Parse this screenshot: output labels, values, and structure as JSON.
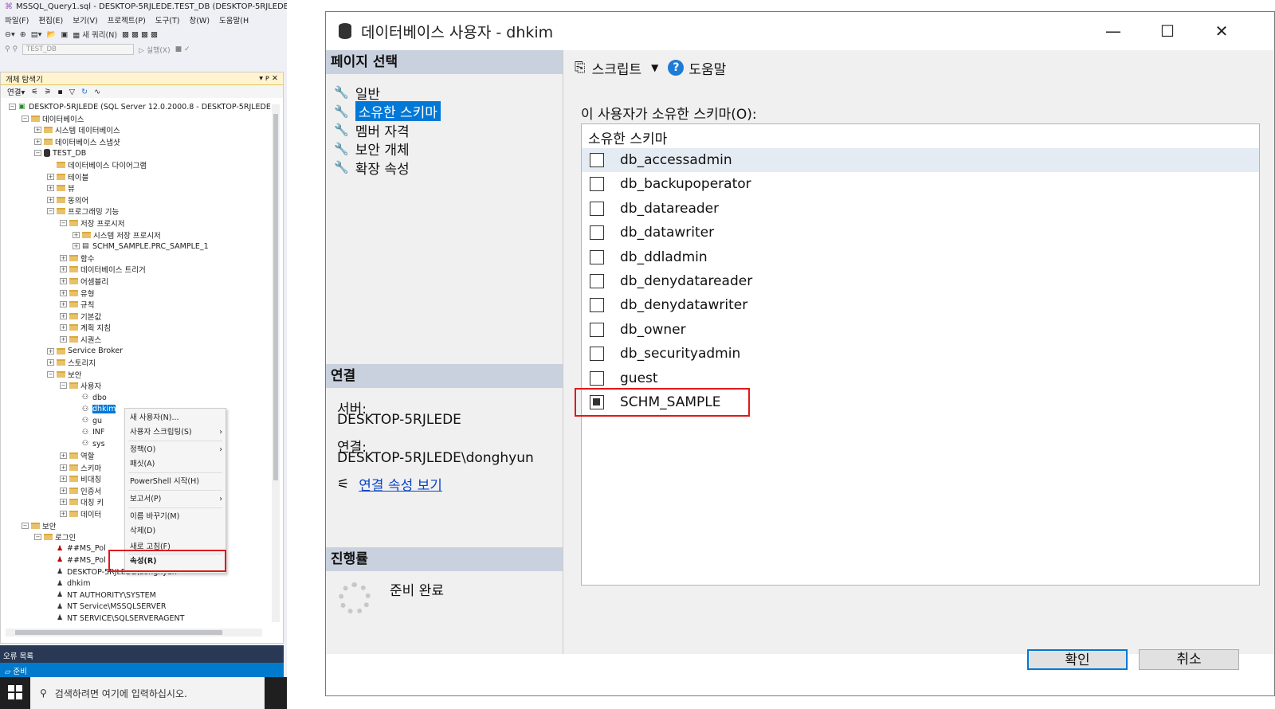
{
  "ssms": {
    "window_title": "MSSQL_Query1.sql - DESKTOP-5RJLEDE.TEST_DB (DESKTOP-5RJLEDE",
    "menu": [
      "파일(F)",
      "편집(E)",
      "보기(V)",
      "프로젝트(P)",
      "도구(T)",
      "창(W)",
      "도움말(H"
    ],
    "toolbar_new_query": "새 쿼리(N)",
    "db_select": "TEST_DB",
    "execute_label": "실행(X)",
    "object_explorer_title": "개체 탐색기",
    "object_explorer_pin": "▾ ᴘ ✕",
    "connect_label": "연결",
    "tree": [
      {
        "level": 0,
        "exp": "⊟",
        "icon": "server",
        "text": "DESKTOP-5RJLEDE (SQL Server 12.0.2000.8 - DESKTOP-5RJLEDE"
      },
      {
        "level": 1,
        "exp": "⊟",
        "icon": "folder",
        "text": "데이터베이스"
      },
      {
        "level": 2,
        "exp": "⊞",
        "icon": "folder",
        "text": "시스템 데이터베이스"
      },
      {
        "level": 2,
        "exp": "⊞",
        "icon": "folder",
        "text": "데이터베이스 스냅샷"
      },
      {
        "level": 2,
        "exp": "⊟",
        "icon": "db",
        "text": "TEST_DB"
      },
      {
        "level": 3,
        "exp": "",
        "icon": "folder",
        "text": "데이터베이스 다이어그램"
      },
      {
        "level": 3,
        "exp": "⊞",
        "icon": "folder",
        "text": "테이블"
      },
      {
        "level": 3,
        "exp": "⊞",
        "icon": "folder",
        "text": "뷰"
      },
      {
        "level": 3,
        "exp": "⊞",
        "icon": "folder",
        "text": "동의어"
      },
      {
        "level": 3,
        "exp": "⊟",
        "icon": "folder",
        "text": "프로그래밍 기능"
      },
      {
        "level": 4,
        "exp": "⊟",
        "icon": "folder",
        "text": "저장 프로시저"
      },
      {
        "level": 5,
        "exp": "⊞",
        "icon": "folder",
        "text": "시스템 저장 프로시저"
      },
      {
        "level": 5,
        "exp": "⊞",
        "icon": "proc",
        "text": "SCHM_SAMPLE.PRC_SAMPLE_1"
      },
      {
        "level": 4,
        "exp": "⊞",
        "icon": "folder",
        "text": "함수"
      },
      {
        "level": 4,
        "exp": "⊞",
        "icon": "folder",
        "text": "데이터베이스 트리거"
      },
      {
        "level": 4,
        "exp": "⊞",
        "icon": "folder",
        "text": "어셈블리"
      },
      {
        "level": 4,
        "exp": "⊞",
        "icon": "folder",
        "text": "유형"
      },
      {
        "level": 4,
        "exp": "⊞",
        "icon": "folder",
        "text": "규칙"
      },
      {
        "level": 4,
        "exp": "⊞",
        "icon": "folder",
        "text": "기본값"
      },
      {
        "level": 4,
        "exp": "⊞",
        "icon": "folder",
        "text": "계획 지침"
      },
      {
        "level": 4,
        "exp": "⊞",
        "icon": "folder",
        "text": "시퀀스"
      },
      {
        "level": 3,
        "exp": "⊞",
        "icon": "folder",
        "text": "Service Broker"
      },
      {
        "level": 3,
        "exp": "⊞",
        "icon": "folder",
        "text": "스토리지"
      },
      {
        "level": 3,
        "exp": "⊟",
        "icon": "folder",
        "text": "보안"
      },
      {
        "level": 4,
        "exp": "⊟",
        "icon": "folder",
        "text": "사용자"
      },
      {
        "level": 5,
        "exp": "",
        "icon": "user",
        "text": "dbo"
      },
      {
        "level": 5,
        "exp": "",
        "icon": "user",
        "text": "dhkim"
      },
      {
        "level": 5,
        "exp": "",
        "icon": "user",
        "text": "gu"
      },
      {
        "level": 5,
        "exp": "",
        "icon": "user",
        "text": "INF"
      },
      {
        "level": 5,
        "exp": "",
        "icon": "user",
        "text": "sys"
      },
      {
        "level": 4,
        "exp": "⊞",
        "icon": "folder",
        "text": "역할"
      },
      {
        "level": 4,
        "exp": "⊞",
        "icon": "folder",
        "text": "스키마"
      },
      {
        "level": 4,
        "exp": "⊞",
        "icon": "folder",
        "text": "비대칭"
      },
      {
        "level": 4,
        "exp": "⊞",
        "icon": "folder",
        "text": "인증서"
      },
      {
        "level": 4,
        "exp": "⊞",
        "icon": "folder",
        "text": "대칭 키"
      },
      {
        "level": 4,
        "exp": "⊞",
        "icon": "folder",
        "text": "데이터"
      },
      {
        "level": 1,
        "exp": "⊟",
        "icon": "folder",
        "text": "보안"
      },
      {
        "level": 2,
        "exp": "⊟",
        "icon": "folder",
        "text": "로그인"
      },
      {
        "level": 3,
        "exp": "",
        "icon": "login-x",
        "text": "##MS_Pol"
      },
      {
        "level": 3,
        "exp": "",
        "icon": "login-x",
        "text": "##MS_Pol"
      },
      {
        "level": 3,
        "exp": "",
        "icon": "login",
        "text": "DESKTOP-5RJLEDE\\donghyun"
      },
      {
        "level": 3,
        "exp": "",
        "icon": "login",
        "text": "dhkim"
      },
      {
        "level": 3,
        "exp": "",
        "icon": "login",
        "text": "NT AUTHORITY\\SYSTEM"
      },
      {
        "level": 3,
        "exp": "",
        "icon": "login",
        "text": "NT Service\\MSSQLSERVER"
      },
      {
        "level": 3,
        "exp": "",
        "icon": "login",
        "text": "NT SERVICE\\SQLSERVERAGENT"
      }
    ],
    "context_menu": [
      {
        "label": "새 사용자(N)...",
        "arrow": ""
      },
      {
        "label": "사용자 스크립팅(S)",
        "arrow": "›"
      },
      {
        "label": "정책(O)",
        "arrow": "›"
      },
      {
        "label": "패싯(A)",
        "arrow": ""
      },
      {
        "label": "PowerShell 시작(H)",
        "arrow": ""
      },
      {
        "label": "보고서(P)",
        "arrow": "›"
      },
      {
        "label": "이름 바꾸기(M)",
        "arrow": ""
      },
      {
        "label": "삭제(D)",
        "arrow": ""
      },
      {
        "label": "새로 고침(F)",
        "arrow": ""
      },
      {
        "label": "속성(R)",
        "arrow": ""
      }
    ],
    "error_list": "오류 목록",
    "status": "준비",
    "taskbar_search": "검색하려면 여기에 입력하십시오.",
    "highlight_color": "#e01818"
  },
  "dialog": {
    "title": "데이터베이스 사용자 - dhkim",
    "page_select_header": "페이지 선택",
    "pages": [
      "일반",
      "소유한 스키마",
      "멤버 자격",
      "보안 개체",
      "확장 속성"
    ],
    "selected_page": 1,
    "connection_header": "연결",
    "server_label": "서버:",
    "server_value": "DESKTOP-5RJLEDE",
    "connection_label": "연결:",
    "connection_value": "DESKTOP-5RJLEDE\\donghyun",
    "view_connection_link": "연결 속성 보기",
    "progress_header": "진행률",
    "progress_status": "준비 완료",
    "script_label": "스크립트",
    "help_label": "도움말",
    "owned_schemas_label": "이 사용자가 소유한 스키마(O):",
    "grid_header": "소유한 스키마",
    "schemas": [
      {
        "name": "db_accessadmin",
        "checked": false
      },
      {
        "name": "db_backupoperator",
        "checked": false
      },
      {
        "name": "db_datareader",
        "checked": false
      },
      {
        "name": "db_datawriter",
        "checked": false
      },
      {
        "name": "db_ddladmin",
        "checked": false
      },
      {
        "name": "db_denydatareader",
        "checked": false
      },
      {
        "name": "db_denydatawriter",
        "checked": false
      },
      {
        "name": "db_owner",
        "checked": false
      },
      {
        "name": "db_securityadmin",
        "checked": false
      },
      {
        "name": "guest",
        "checked": false
      },
      {
        "name": "SCHM_SAMPLE",
        "checked": true
      }
    ],
    "ok_label": "확인",
    "cancel_label": "취소"
  }
}
